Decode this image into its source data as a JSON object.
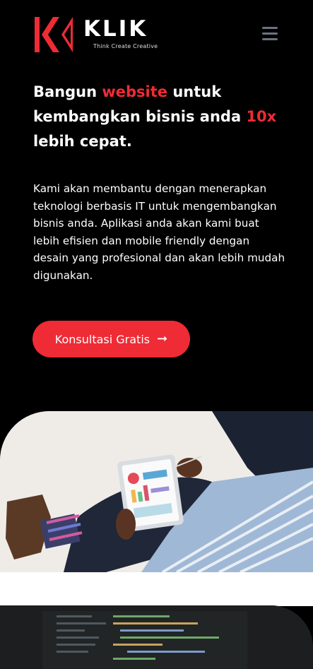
{
  "brand": {
    "name": "KLIK",
    "tagline": "Think Create Creative",
    "accent_color": "#ef2b35"
  },
  "nav": {
    "menu_icon": "hamburger-menu-icon"
  },
  "hero": {
    "headline_part1": "Bangun ",
    "headline_accent1": "website",
    "headline_part2": " untuk kembangkan bisnis anda ",
    "headline_accent2": "10x",
    "headline_part3": " lebih cepat.",
    "description": "Kami akan membantu dengan menerapkan teknologi berbasis IT untuk mengembangkan bisnis anda. Aplikasi anda akan kami buat lebih efisien dan mobile friendly dengan desain yang profesional dan akan lebih mudah digunakan.",
    "cta_label": "Konsultasi Gratis",
    "cta_icon": "arrow-right-icon"
  }
}
